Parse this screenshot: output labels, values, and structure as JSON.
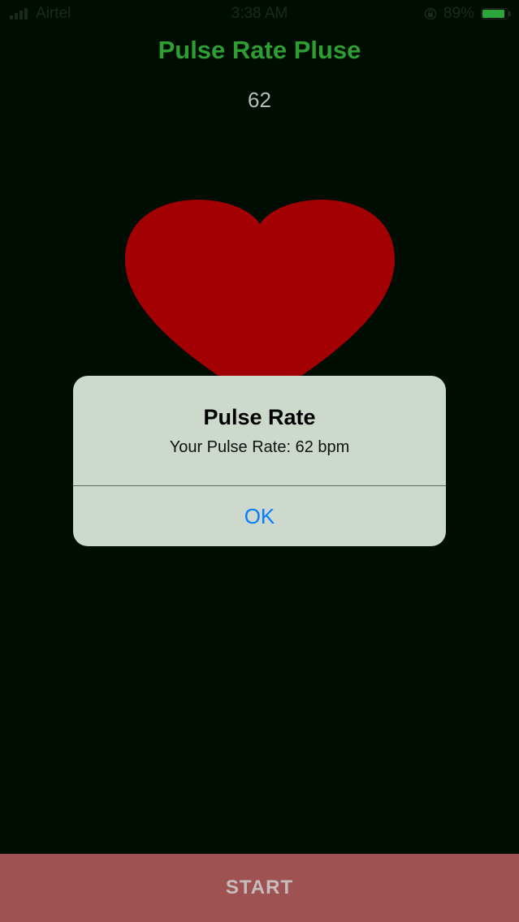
{
  "status_bar": {
    "carrier": "Airtel",
    "time": "3:38 AM",
    "battery": "89%",
    "battery_level": 0.89,
    "icons": [
      "signal-icon",
      "lock-rotation-icon",
      "battery-icon"
    ]
  },
  "app": {
    "title": "Pulse Rate Pluse",
    "pulse_value": "62",
    "heart_icon": "heart-icon"
  },
  "alert": {
    "title": "Pulse Rate",
    "message": "Your Pulse Rate: 62 bpm",
    "ok_label": "OK"
  },
  "footer": {
    "start_label": "START"
  },
  "colors": {
    "background": "#000d02",
    "title_green": "#2e9e33",
    "heart_red": "#a30004",
    "alert_bg": "#ccd9cc",
    "ok_blue": "#0a7aff",
    "start_bg": "#9e5252",
    "battery_green": "#2aa63a"
  }
}
